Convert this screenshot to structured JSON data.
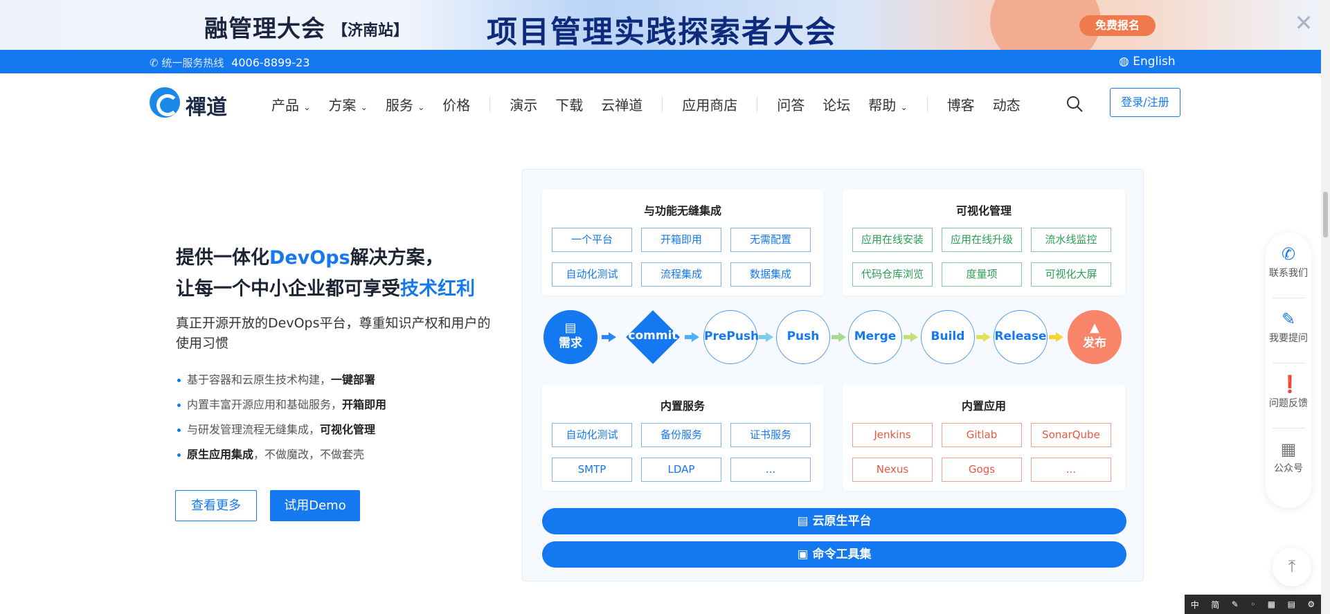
{
  "banner": {
    "left_title": "融管理大会",
    "city": "【济南站】",
    "title": "项目管理实践探索者大会",
    "cta": "免费报名",
    "close": "✕"
  },
  "topbar": {
    "hotline_label": "统一服务热线",
    "hotline_number": "4006-8899-23",
    "language": "English"
  },
  "nav": {
    "logo_text": "禪道",
    "items": [
      "产品",
      "方案",
      "服务",
      "价格",
      "演示",
      "下载",
      "云禅道",
      "应用商店",
      "问答",
      "论坛",
      "帮助",
      "博客",
      "动态"
    ],
    "login": "登录/注册"
  },
  "hero": {
    "line1_pre": "提供一体化",
    "line1_hl": "DevOps",
    "line1_post": "解决方案，",
    "line2_pre": "让每一个中小企业都可享受",
    "line2_hl": "技术红利",
    "desc": "真正开源开放的DevOps平台，尊重知识产权和用户的使用习惯",
    "bullets": [
      {
        "text": "基于容器和云原生技术构建，",
        "bold": "一键部署"
      },
      {
        "text": "内置丰富开源应用和基础服务，",
        "bold": "开箱即用"
      },
      {
        "text": "与研发管理流程无缝集成，",
        "bold": "可视化管理"
      },
      {
        "bold": "原生应用集成",
        "text": "，不做魔改，不做套壳"
      }
    ],
    "btn_more": "查看更多",
    "btn_demo": "试用Demo"
  },
  "diagram": {
    "card1": {
      "title": "与功能无缝集成",
      "tags": [
        "一个平台",
        "开箱即用",
        "无需配置",
        "自动化测试",
        "流程集成",
        "数据集成"
      ]
    },
    "card2": {
      "title": "可视化管理",
      "tags": [
        "应用在线安装",
        "应用在线升级",
        "流水线监控",
        "代码仓库浏览",
        "度量项",
        "可视化大屏"
      ]
    },
    "flow": {
      "start": "需求",
      "commit": "commit",
      "nodes": [
        "PrePush",
        "Push",
        "Merge",
        "Build",
        "Release"
      ],
      "end": "发布"
    },
    "card3": {
      "title": "内置服务",
      "tags": [
        "自动化测试",
        "备份服务",
        "证书服务",
        "SMTP",
        "LDAP",
        "..."
      ]
    },
    "card4": {
      "title": "内置应用",
      "tags": [
        "Jenkins",
        "Gitlab",
        "SonarQube",
        "Nexus",
        "Gogs",
        "..."
      ]
    },
    "bar1": "云原生平台",
    "bar2": "命令工具集"
  },
  "float": {
    "items": [
      "联系我们",
      "我要提问",
      "问题反馈",
      "公众号"
    ]
  },
  "ime": [
    "中",
    "简"
  ],
  "colors": {
    "primary": "#1478f0",
    "green": "#2a9d55",
    "red": "#e9573f",
    "orange": "#f07a4e"
  }
}
